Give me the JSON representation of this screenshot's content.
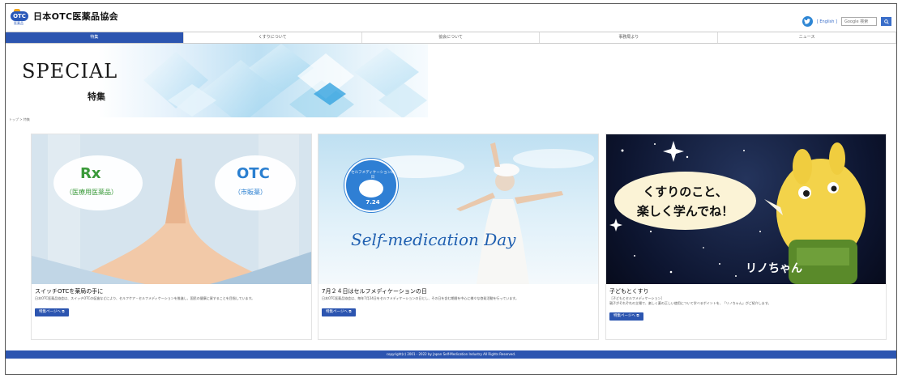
{
  "header": {
    "logo_mark": "OTC",
    "logo_sub": "医薬品",
    "org_name": "日本OTC医薬品協会",
    "english_link": "[ English ]",
    "search_placeholder": "Google 検索"
  },
  "nav": {
    "items": [
      {
        "label": "特集",
        "active": true
      },
      {
        "label": "くすりについて",
        "active": false
      },
      {
        "label": "協会について",
        "active": false
      },
      {
        "label": "事務局より",
        "active": false
      },
      {
        "label": "ニュース",
        "active": false
      }
    ]
  },
  "hero": {
    "title": "SPECIAL",
    "subtitle": "特集"
  },
  "breadcrumb": "トップ > 特集",
  "cards": [
    {
      "image": {
        "rx": "Rx",
        "rx_sub": "（医療用医薬品）",
        "otc": "OTC",
        "otc_sub": "（市販薬）"
      },
      "title": "スイッチOTCを薬局の手に",
      "desc": "日本OTC医薬品協会は、スイッチOTCの促進などにより、セルフケア・セルフメディケーションを推進し、国民の健康に資することを目指しています。",
      "button": "特集ページへ"
    },
    {
      "image": {
        "badge_top": "セルフメディケーションの日",
        "badge_date": "7.24",
        "caption": "Self-medication Day"
      },
      "title": "7月２４日はセルフメディケーションの日",
      "desc": "日本OTC医薬品協会は、毎年7月24日をセルフメディケーションの日とし、その日を含む期間を中心に様々な啓発活動を行っています。",
      "button": "特集ページへ"
    },
    {
      "image": {
        "bubble_line1": "くすりのこと、",
        "bubble_line2": "楽しく学んでね！",
        "character": "リノちゃん"
      },
      "title": "子どもとくすり",
      "desc1": "［子どもとセルフメディケーション］",
      "desc2": "親子がそれぞれの立場で、楽しく薬の正しい使用について学べるポイントを、「リノちゃん」がご紹介します。",
      "button": "特集ページへ"
    }
  ],
  "footer": {
    "copyright": "copyright(c) 2001 - 2022 by Japan Self-Medication Industry All Rights Reserved."
  },
  "colors": {
    "brand_blue": "#2c55b0",
    "logo_orange": "#f2a51b",
    "rx_green": "#3a9a3a",
    "otc_blue": "#2a7fd0"
  }
}
